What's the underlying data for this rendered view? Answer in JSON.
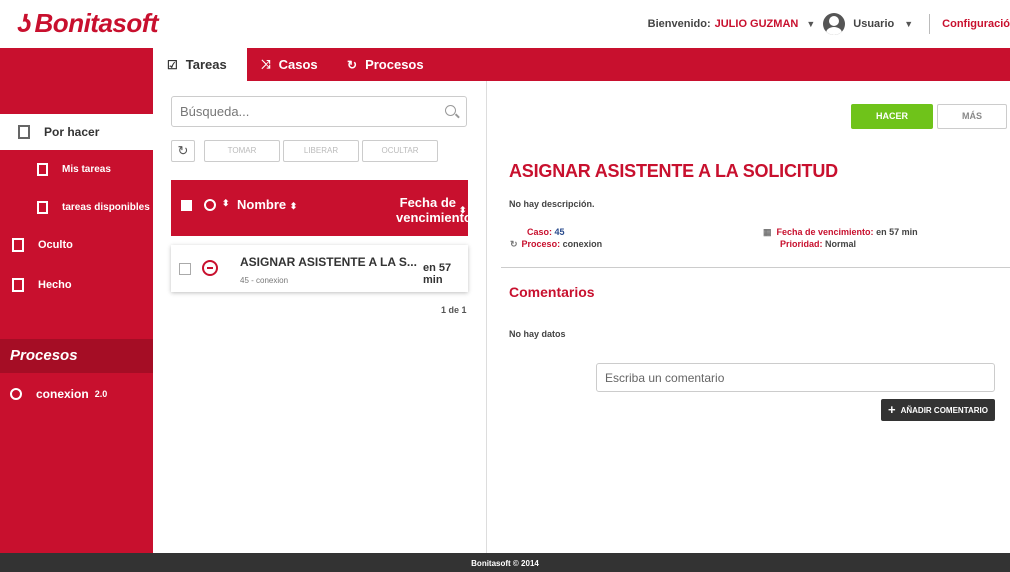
{
  "header": {
    "logo_text": "Bonitasoft",
    "welcome_label": "Bienvenido:",
    "user_name": "JULIO GUZMAN",
    "user_role": "Usuario",
    "config_label": "Configuració"
  },
  "tabs": [
    {
      "label": "Tareas",
      "icon": "checkbox-icon",
      "active": true
    },
    {
      "label": "Casos",
      "icon": "shuffle-icon",
      "active": false
    },
    {
      "label": "Procesos",
      "icon": "process-icon",
      "active": false
    }
  ],
  "sidebar": {
    "items": [
      {
        "label": "Por hacer",
        "icon": "inbox-icon",
        "active": true
      },
      {
        "label": "Mis tareas",
        "icon": "my-tasks-icon",
        "active": false
      },
      {
        "label": "tareas disponibles",
        "icon": "available-tasks-icon",
        "active": false
      },
      {
        "label": "Oculto",
        "icon": "hidden-icon",
        "active": false
      },
      {
        "label": "Hecho",
        "icon": "done-icon",
        "active": false
      }
    ],
    "procesos_heading": "Procesos",
    "process": {
      "name": "conexion",
      "version": "2.0"
    }
  },
  "list": {
    "search_placeholder": "Búsqueda...",
    "toolbar": {
      "take": "TOMAR",
      "release": "LIBERAR",
      "hide": "OCULTAR"
    },
    "columns": {
      "name": "Nombre",
      "due_line1": "Fecha de",
      "due_line2": "vencimiento"
    },
    "rows": [
      {
        "title": "ASIGNAR ASISTENTE A LA S...",
        "subtitle": "45 - conexion",
        "due": "en 57 min"
      }
    ],
    "pager": "1 de 1"
  },
  "detail": {
    "do_button": "HACER",
    "more_button": "MÁS",
    "title": "ASIGNAR ASISTENTE A LA SOLICITUD",
    "description": "No hay descripción.",
    "case_label": "Caso:",
    "case_value": "45",
    "process_label": "Proceso:",
    "process_value": "conexion",
    "due_label": "Fecha de vencimiento:",
    "due_value": "en 57 min",
    "priority_label": "Prioridad:",
    "priority_value": "Normal",
    "comments_heading": "Comentarios",
    "no_data": "No hay datos",
    "comment_placeholder": "Escriba un comentario",
    "add_comment_button": "AÑADIR COMENTARIO"
  },
  "footer": {
    "text": "Bonitasoft © 2014"
  },
  "colors": {
    "brand": "#c8102e",
    "accent_green": "#6fc31a",
    "footer": "#333333"
  }
}
